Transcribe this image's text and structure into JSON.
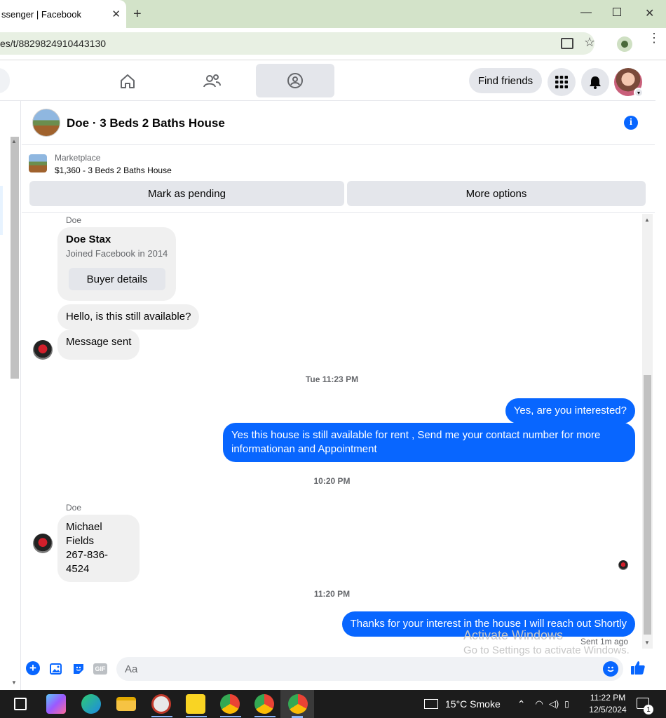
{
  "browser": {
    "tab_title": "ssenger | Facebook",
    "url": "es/t/8829824910443130"
  },
  "nav": {
    "find_friends": "Find friends"
  },
  "chat": {
    "title": "Doe · 3 Beds 2 Baths House",
    "marketplace_label": "Marketplace",
    "listing": "$1,360 - 3 Beds 2 Baths House",
    "mark_pending": "Mark as pending",
    "more_options": "More options"
  },
  "messages": {
    "sender1": "Doe",
    "card_name": "Doe Stax",
    "card_joined": "Joined Facebook in 2014",
    "buyer_details": "Buyer details",
    "msg1": "Hello, is this still available?",
    "msg2": "Message sent",
    "ts1": "Tue 11:23 PM",
    "out1": "Yes, are you interested?",
    "out2": "Yes this house is still available for rent , Send me your contact number for more informationan and Appointment",
    "ts2": "10:20 PM",
    "sender2": "Doe",
    "msg3_line1": "Michael Fields",
    "msg3_line2": "267-836-4524",
    "ts3": "11:20 PM",
    "out3": "Thanks for your interest in the house I will reach out Shortly",
    "sent_status": "Sent 1m ago"
  },
  "composer": {
    "placeholder": "Aa"
  },
  "watermark": {
    "line1": "Activate Windows",
    "line2": "Go to Settings to activate Windows."
  },
  "taskbar": {
    "weather": "15°C  Smoke",
    "time": "11:22 PM",
    "date": "12/5/2024",
    "notif_count": "1"
  },
  "colors": {
    "accent": "#0866ff",
    "tabbar": "#d3e3c9"
  }
}
